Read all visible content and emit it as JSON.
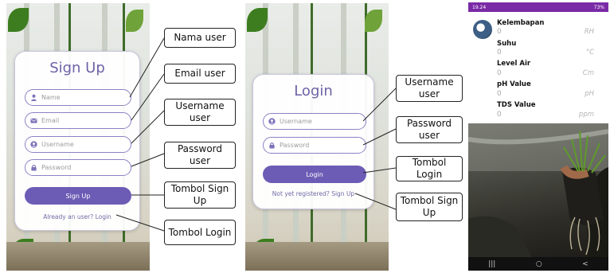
{
  "signup": {
    "title": "Sign Up",
    "name_placeholder": "Name",
    "email_placeholder": "Email",
    "username_placeholder": "Username",
    "password_placeholder": "Password",
    "button": "Sign Up",
    "login_link": "Already an user? Login"
  },
  "login": {
    "title": "Login",
    "username_placeholder": "Username",
    "password_placeholder": "Password",
    "button": "Login",
    "register_link": "Not yet registered? Sign Up"
  },
  "callouts": {
    "nama_user": "Nama user",
    "email_user": "Email user",
    "username_user_1": "Username user",
    "password_user_1": "Password user",
    "tombol_signup_1": "Tombol Sign Up",
    "tombol_login_1": "Tombol Login",
    "username_user_2": "Username user",
    "password_user_2": "Password user",
    "tombol_login_2": "Tombol Login",
    "tombol_signup_2": "Tombol Sign Up"
  },
  "monitor": {
    "status_time": "19.24",
    "status_right": "73%",
    "readings": [
      {
        "label": "Kelembapan",
        "value": "0",
        "unit": "RH"
      },
      {
        "label": "Suhu",
        "value": "0",
        "unit": "°C"
      },
      {
        "label": "Level Air",
        "value": "0",
        "unit": "Cm"
      },
      {
        "label": "pH Value",
        "value": "0",
        "unit": "pH"
      },
      {
        "label": "TDS Value",
        "value": "0",
        "unit": "ppm"
      }
    ],
    "nav": {
      "recent": "|||",
      "home": "○",
      "back": "<"
    }
  },
  "colors": {
    "accent": "#6d5cb5",
    "title": "#6d63a8",
    "status_bar": "#7a2aa6"
  },
  "icons": {
    "name": "person-icon",
    "email": "envelope-icon",
    "username": "user-circle-icon",
    "password": "lock-icon"
  }
}
